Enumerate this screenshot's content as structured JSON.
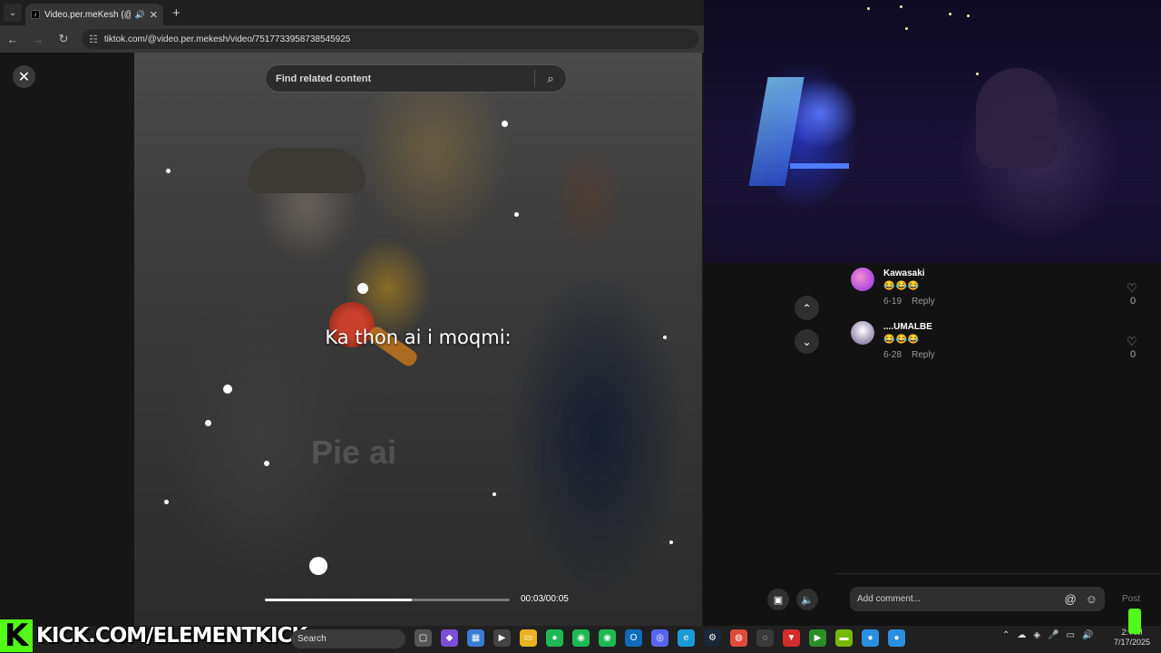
{
  "browser": {
    "tab_title": "Video.per.meKesh (@video",
    "url": "tiktok.com/@video.per.mekesh/video/7517733958738545925"
  },
  "viewer": {
    "search_placeholder": "Find related content",
    "caption": "Ka thon ai i moqmi:",
    "watermark": "Pie   ai",
    "time": "00:03/00:05",
    "progress_fraction": 0.6
  },
  "comments": [
    {
      "user": "Kawasaki",
      "emojis": "😂😂😂",
      "date": "6-19",
      "reply_label": "Reply",
      "likes": "0",
      "avatar_color": "#c04bd8"
    },
    {
      "user": "....UMALBE",
      "emojis": "😂😂😂",
      "date": "6-28",
      "reply_label": "Reply",
      "likes": "0",
      "avatar_color": "#d7d2e0"
    }
  ],
  "comment_input": {
    "placeholder": "Add comment...",
    "post_label": "Post"
  },
  "overlay": {
    "kick_letter": "K",
    "kick_url": "KICK.COM/ELEMENTKICK"
  },
  "taskbar": {
    "search_label": "Search",
    "time": "2:  AM",
    "date": "7/17/2025",
    "app_icons": [
      {
        "name": "task-view-icon",
        "glyph": "▢",
        "color": "#555555"
      },
      {
        "name": "copilot-icon",
        "glyph": "◆",
        "color": "#7a4fd6"
      },
      {
        "name": "store-icon",
        "glyph": "▦",
        "color": "#3a7bd5"
      },
      {
        "name": "media-player-icon",
        "glyph": "▶",
        "color": "#444444"
      },
      {
        "name": "explorer-icon",
        "glyph": "▭",
        "color": "#e8b323"
      },
      {
        "name": "spotify-icon",
        "glyph": "●",
        "color": "#1db954"
      },
      {
        "name": "app-green-1-icon",
        "glyph": "◉",
        "color": "#1db954"
      },
      {
        "name": "app-green-2-icon",
        "glyph": "◉",
        "color": "#1db954"
      },
      {
        "name": "outlook-icon",
        "glyph": "O",
        "color": "#0f6cbd"
      },
      {
        "name": "discord-icon",
        "glyph": "◎",
        "color": "#5865f2"
      },
      {
        "name": "edge-icon",
        "glyph": "e",
        "color": "#1b9bd6"
      },
      {
        "name": "steam-icon",
        "glyph": "⚙",
        "color": "#1b2838"
      },
      {
        "name": "chrome-icon",
        "glyph": "◍",
        "color": "#e04a3a"
      },
      {
        "name": "obs-icon",
        "glyph": "◌",
        "color": "#3a3a3a"
      },
      {
        "name": "vpn-icon",
        "glyph": "▼",
        "color": "#d52b2b"
      },
      {
        "name": "kick-app-icon",
        "glyph": "▶",
        "color": "#2a8f2a"
      },
      {
        "name": "nvidia-icon",
        "glyph": "▬",
        "color": "#76b900"
      },
      {
        "name": "app-blue-1-icon",
        "glyph": "●",
        "color": "#2a8fe0"
      },
      {
        "name": "app-blue-2-icon",
        "glyph": "●",
        "color": "#2a8fe0"
      }
    ]
  }
}
